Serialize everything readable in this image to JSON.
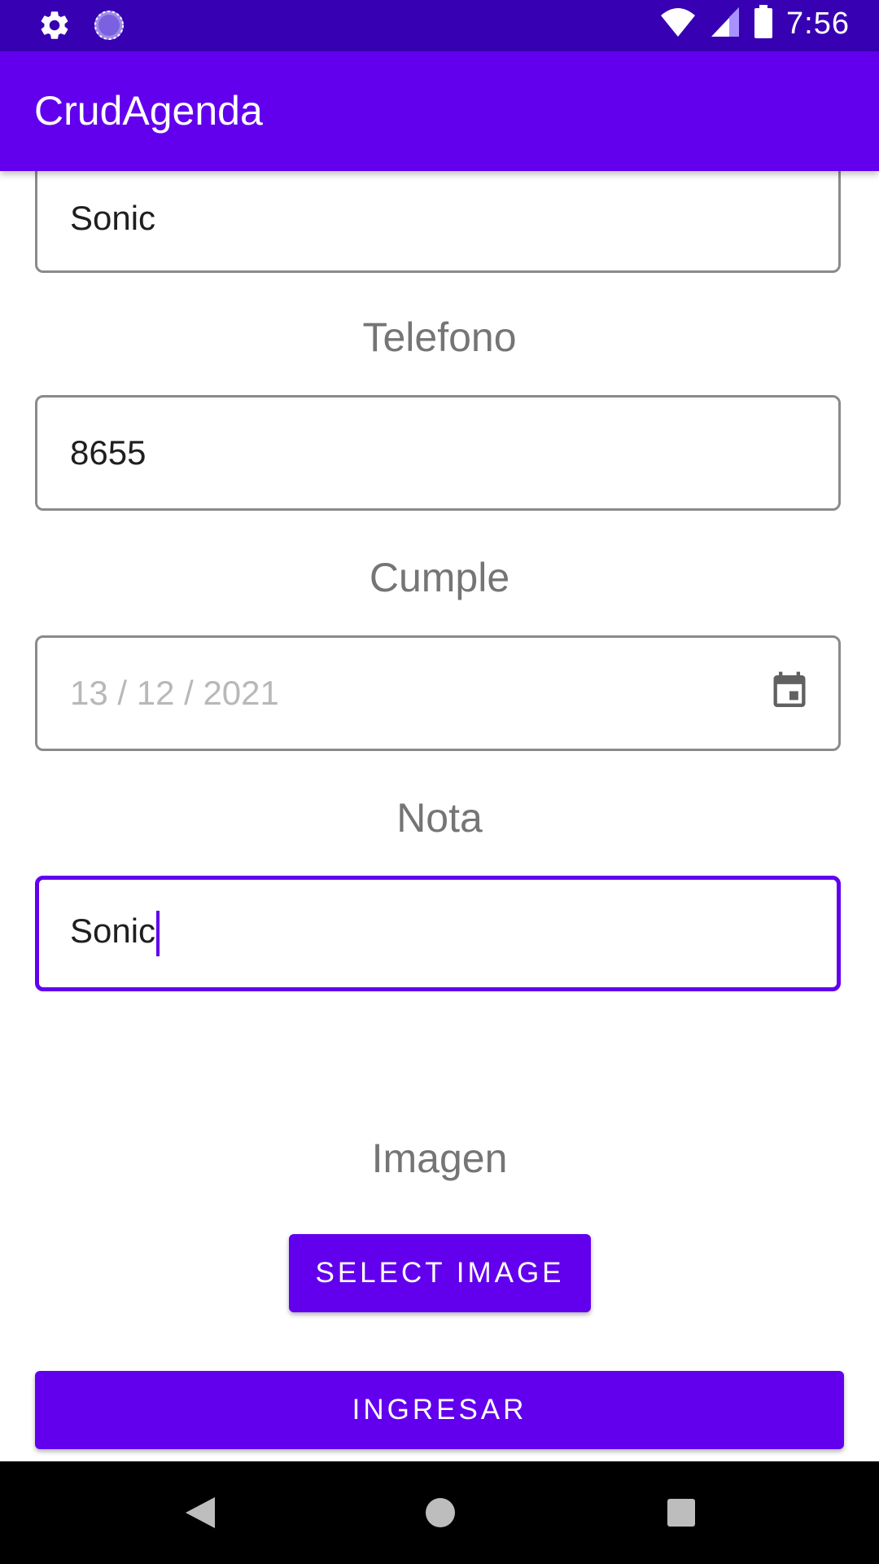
{
  "status_bar": {
    "time": "7:56",
    "icons": [
      "gear-icon",
      "sync-icon",
      "wifi-icon",
      "signal-icon",
      "battery-icon"
    ]
  },
  "app_bar": {
    "title": "CrudAgenda"
  },
  "form": {
    "name_value": "Sonic",
    "phone_label": "Telefono",
    "phone_value": "8655",
    "birthday_label": "Cumple",
    "birthday_placeholder": "13 / 12 / 2021",
    "note_label": "Nota",
    "note_value": "Sonic",
    "image_label": "Imagen",
    "select_image_button": "SELECT IMAGE",
    "submit_button": "INGRESAR"
  },
  "nav_bar": {
    "icons": [
      "back-icon",
      "home-icon",
      "recents-icon"
    ]
  },
  "colors": {
    "primary": "#6200EE",
    "primary_dark": "#3700B3",
    "label_gray": "#757575",
    "placeholder_gray": "#b8b8b8"
  }
}
